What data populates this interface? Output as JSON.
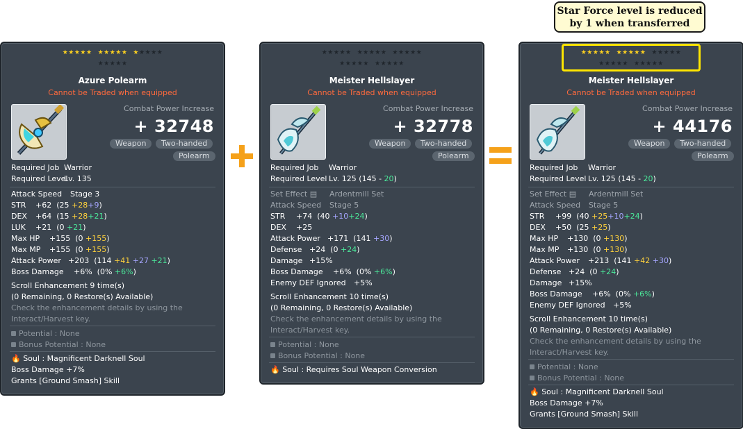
{
  "plus_sign": "+",
  "equals_sign": "=",
  "callout": {
    "line1": "Star Force level is reduced",
    "line2": "by 1 when transferred"
  },
  "cards": [
    {
      "stars": {
        "row1": [
          "★★★★★",
          "★★★★★",
          "★"
        ],
        "row1_off": [
          "",
          "",
          "★★★★"
        ],
        "row2": "★★★★★",
        "lit": 11
      },
      "name": "Azure Polearm",
      "trade": "Cannot be Traded when equipped",
      "icon": "polearm-icon",
      "cp_label": "Combat Power Increase",
      "cp_plus": "+",
      "cp_value": "32748",
      "tags": [
        "Weapon",
        "Two-handed",
        "Polearm"
      ],
      "req_job_label": "Required Job",
      "req_job": "Warrior",
      "req_level_label": "Required Level",
      "req_level": "Lv. 135",
      "stats": [
        {
          "label": "Attack Speed",
          "value": "Stage 3"
        },
        {
          "label": "STR",
          "value": "+62",
          "detail": [
            "(25 ",
            "+28",
            "+9",
            ")"
          ]
        },
        {
          "label": "DEX",
          "value": "+64",
          "detail": [
            "(15 ",
            "+28",
            "+21",
            ")"
          ]
        },
        {
          "label": "LUK",
          "value": "+21",
          "detail": [
            "(0 ",
            "",
            "+21",
            ")"
          ]
        },
        {
          "label": "Max HP",
          "value": "+155",
          "detail": [
            "(0 ",
            "+155",
            "",
            ")"
          ]
        },
        {
          "label": "Max MP",
          "value": "+155",
          "detail": [
            "(0 ",
            "+155",
            "",
            ")"
          ]
        },
        {
          "label": "Attack Power",
          "value": "+203",
          "detail": [
            "(114 ",
            "+41",
            "+27",
            "+21",
            ")"
          ]
        },
        {
          "label": "Boss Damage",
          "value": "+6%",
          "detail": [
            "(0% ",
            "",
            "+6%",
            ")"
          ]
        }
      ],
      "scroll": "Scroll Enhancement 9 time(s)",
      "restore": "(0 Remaining, 0 Restore(s) Available)",
      "check1": "Check the enhancement details by using the",
      "check2": "Interact/Harvest key.",
      "potential": "Potential : None",
      "bonus_potential": "Bonus Potential : None",
      "soul": "Soul : Magnificent Darknell Soul",
      "soul_effect": "Boss Damage +7%",
      "soul_skill": "Grants [Ground Smash] Skill"
    },
    {
      "name": "Meister Hellslayer",
      "trade": "Cannot be Traded when equipped",
      "icon": "hellslayer-icon",
      "cp_label": "Combat Power Increase",
      "cp_plus": "+",
      "cp_value": "32778",
      "tags": [
        "Weapon",
        "Two-handed",
        "Polearm"
      ],
      "req_job_label": "Required Job",
      "req_job": "Warrior",
      "req_level_label": "Required Level",
      "req_level": "Lv. 125",
      "req_level_extra": [
        "(145 - ",
        "20",
        ")"
      ],
      "set_effect_label": "Set Effect",
      "set_effect": "Ardentmill Set",
      "stats": [
        {
          "label": "Attack Speed",
          "value": "Stage 5"
        },
        {
          "label": "STR",
          "value": "+74",
          "detail": [
            "(40 ",
            "+10",
            "+24",
            ")"
          ]
        },
        {
          "label": "DEX",
          "value": "+25"
        },
        {
          "label": "Attack Power",
          "value": "+171",
          "detail": [
            "(141 ",
            "+30",
            ")"
          ]
        },
        {
          "label": "Defense",
          "value": "+24",
          "detail": [
            "(0 ",
            "+24",
            ")"
          ]
        },
        {
          "label": "Damage",
          "value": "+15%"
        },
        {
          "label": "Boss Damage",
          "value": "+6%",
          "detail": [
            "(0% ",
            "+6%",
            ")"
          ]
        },
        {
          "label": "Enemy DEF Ignored",
          "value": "+5%"
        }
      ],
      "scroll": "Scroll Enhancement 10 time(s)",
      "restore": "(0 Remaining, 0 Restore(s) Available)",
      "check1": "Check the enhancement details by using the",
      "check2": "Interact/Harvest key.",
      "potential": "Potential : None",
      "bonus_potential": "Bonus Potential : None",
      "soul": "Soul : Requires Soul Weapon Conversion"
    },
    {
      "name": "Meister Hellslayer",
      "trade": "Cannot be Traded when equipped",
      "icon": "hellslayer-icon",
      "cp_label": "Combat Power Increase",
      "cp_plus": "+",
      "cp_value": "44176",
      "tags": [
        "Weapon",
        "Two-handed",
        "Polearm"
      ],
      "req_job_label": "Required Job",
      "req_job": "Warrior",
      "req_level_label": "Required Level",
      "req_level": "Lv. 125",
      "req_level_extra": [
        "(145 - ",
        "20",
        ")"
      ],
      "set_effect_label": "Set Effect",
      "set_effect": "Ardentmill Set",
      "stats": [
        {
          "label": "Attack Speed",
          "value": "Stage 5"
        },
        {
          "label": "STR",
          "value": "+99",
          "detail": [
            "(40 ",
            "+25",
            "+10",
            "+24",
            ")"
          ]
        },
        {
          "label": "DEX",
          "value": "+50",
          "detail": [
            "(25 ",
            "+25",
            ")"
          ]
        },
        {
          "label": "Max HP",
          "value": "+130",
          "detail": [
            "(0 ",
            "+130",
            ")"
          ]
        },
        {
          "label": "Max MP",
          "value": "+130",
          "detail": [
            "(0 ",
            "+130",
            ")"
          ]
        },
        {
          "label": "Attack Power",
          "value": "+213",
          "detail": [
            "(141 ",
            "+42",
            "+30",
            ")"
          ]
        },
        {
          "label": "Defense",
          "value": "+24",
          "detail": [
            "(0 ",
            "+24",
            ")"
          ]
        },
        {
          "label": "Damage",
          "value": "+15%"
        },
        {
          "label": "Boss Damage",
          "value": "+6%",
          "detail": [
            "(0% ",
            "+6%",
            ")"
          ]
        },
        {
          "label": "Enemy DEF Ignored",
          "value": "+5%"
        }
      ],
      "scroll": "Scroll Enhancement 10 time(s)",
      "restore": "(0 Remaining, 0 Restore(s) Available)",
      "check1": "Check the enhancement details by using the",
      "check2": "Interact/Harvest key.",
      "potential": "Potential : None",
      "bonus_potential": "Bonus Potential : None",
      "soul": "Soul : Magnificent Darknell Soul",
      "soul_effect": "Boss Damage +7%",
      "soul_skill": "Grants [Ground Smash] Skill"
    }
  ]
}
